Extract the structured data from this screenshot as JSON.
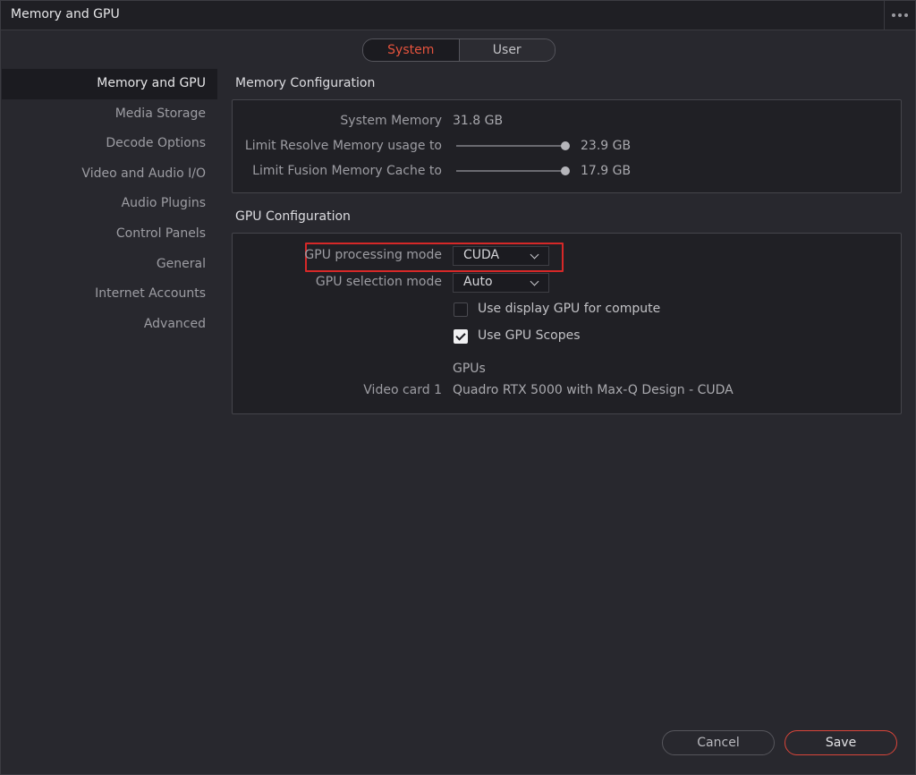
{
  "window": {
    "title": "Memory and GPU"
  },
  "segmented": {
    "system": "System",
    "user": "User"
  },
  "sidebar": {
    "items": [
      {
        "label": "Memory and GPU"
      },
      {
        "label": "Media Storage"
      },
      {
        "label": "Decode Options"
      },
      {
        "label": "Video and Audio I/O"
      },
      {
        "label": "Audio Plugins"
      },
      {
        "label": "Control Panels"
      },
      {
        "label": "General"
      },
      {
        "label": "Internet Accounts"
      },
      {
        "label": "Advanced"
      }
    ]
  },
  "memory": {
    "section_title": "Memory Configuration",
    "system_memory_label": "System Memory",
    "system_memory_value": "31.8 GB",
    "resolve_label": "Limit Resolve Memory usage to",
    "resolve_value": "23.9 GB",
    "resolve_fraction": 1.0,
    "fusion_label": "Limit Fusion Memory Cache to",
    "fusion_value": "17.9 GB",
    "fusion_fraction": 1.0
  },
  "gpu": {
    "section_title": "GPU Configuration",
    "processing_mode_label": "GPU processing mode",
    "processing_mode_value": "CUDA",
    "selection_mode_label": "GPU selection mode",
    "selection_mode_value": "Auto",
    "display_gpu_label": "Use display GPU for compute",
    "display_gpu_checked": false,
    "scopes_label": "Use GPU Scopes",
    "scopes_checked": true,
    "gpus_heading": "GPUs",
    "video_card_label": "Video card 1",
    "video_card_value": "Quadro RTX 5000 with Max-Q Design - CUDA"
  },
  "footer": {
    "cancel_label": "Cancel",
    "save_label": "Save"
  },
  "colors": {
    "accent": "#e5533d",
    "highlight": "#d62828",
    "background": "#28282e"
  }
}
